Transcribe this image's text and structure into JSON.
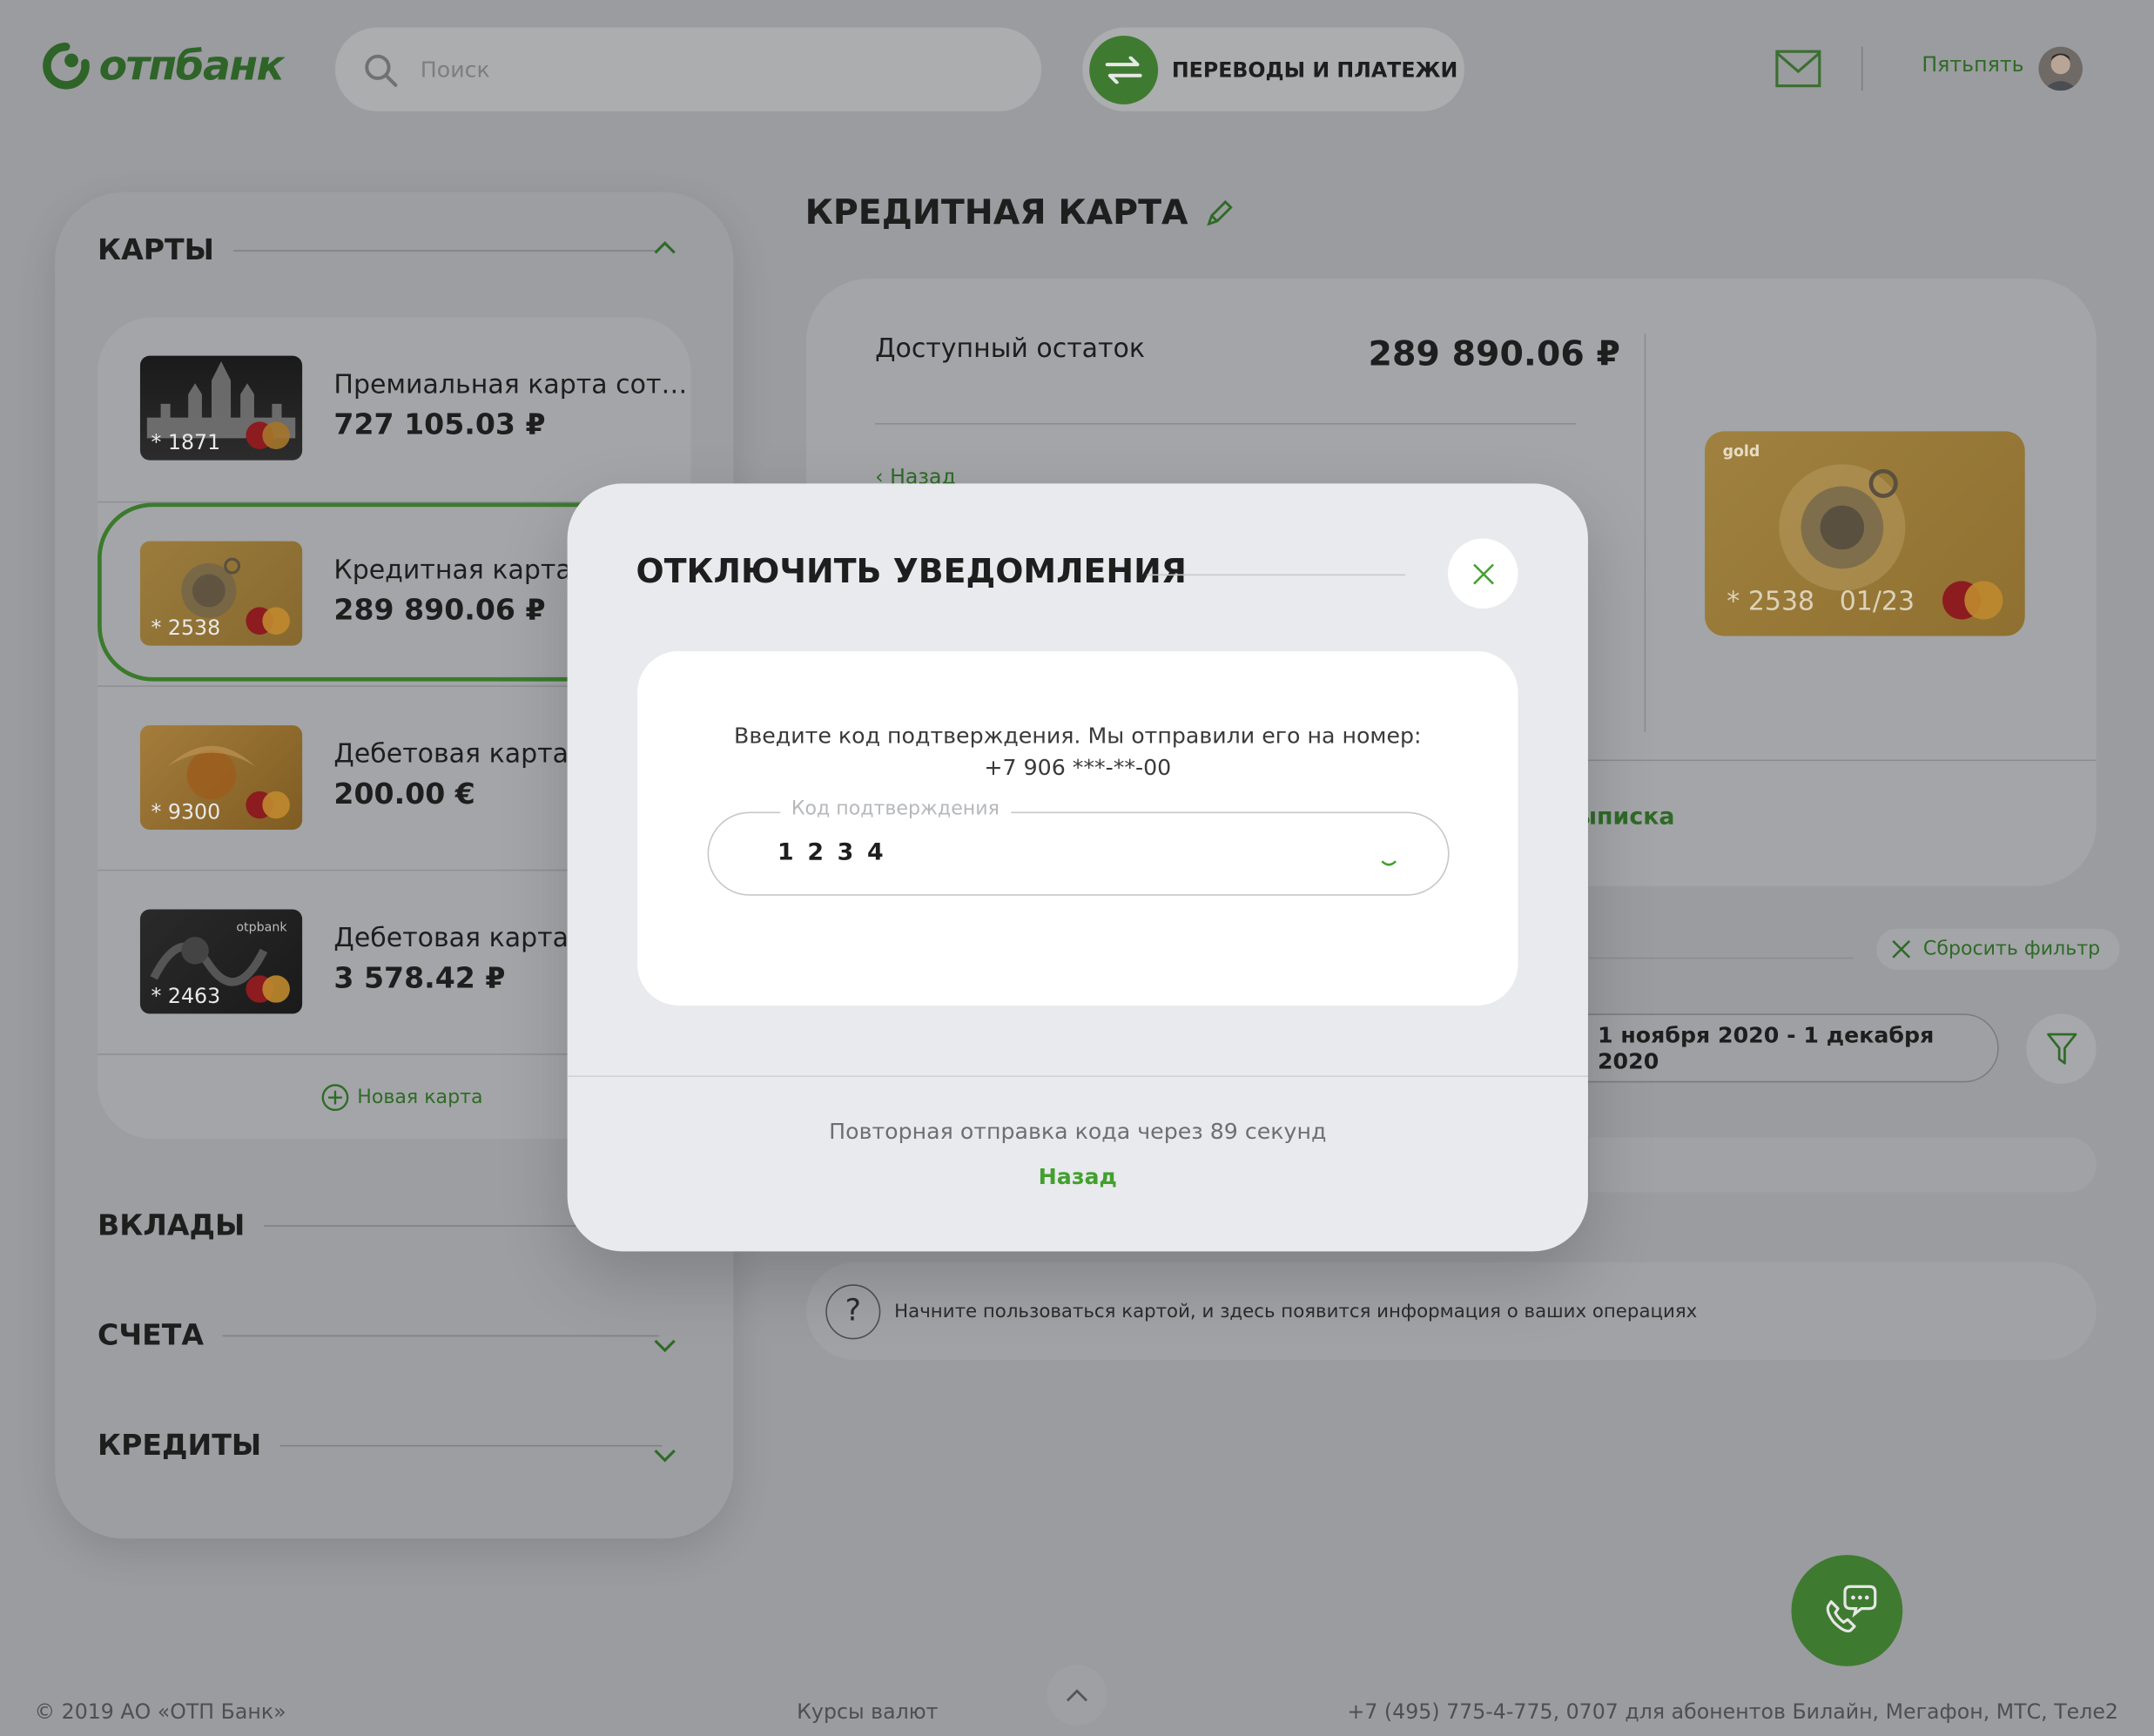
{
  "brand": {
    "name": "отпбанк",
    "green": "#3f7a31",
    "accent": "#43a02f"
  },
  "header": {
    "search_placeholder": "Поиск",
    "transfers_label": "ПЕРЕВОДЫ И ПЛАТЕЖИ",
    "user_name": "Пятьпять",
    "icons": [
      "search-icon",
      "transfer-arrows-icon",
      "mail-icon",
      "avatar"
    ]
  },
  "sidebar": {
    "cards_title": "КАРТЫ",
    "cards": [
      {
        "name": "Премиальная карта сот…",
        "balance": "727 105.03 ₽",
        "mask": "* 1871",
        "style": "dark-cathedral"
      },
      {
        "name": "Кредитная карта",
        "balance": "289 890.06 ₽",
        "mask": "* 2538",
        "style": "gold-watch",
        "selected": true
      },
      {
        "name": "Дебетовая карта",
        "balance": "200.00 €",
        "mask": "* 9300",
        "style": "gold-orange"
      },
      {
        "name": "Дебетовая карта",
        "balance": "3 578.42 ₽",
        "mask": "* 2463",
        "style": "dark-ornament"
      }
    ],
    "new_card": "Новая карта",
    "deposits_title": "ВКЛАДЫ",
    "accounts_title": "СЧЕТА",
    "credits_title": "КРЕДИТЫ"
  },
  "main": {
    "title": "КРЕДИТНАЯ КАРТА",
    "available_label": "Доступный остаток",
    "available_value": "289 890.06 ₽",
    "back_link": "Назад",
    "statement_link": "ыписка",
    "card": {
      "tier": "gold",
      "mask": "* 2538",
      "expiry": "01/23"
    },
    "reset_filter": "Сбросить фильтр",
    "date_range": "1 ноября 2020 - 1 декабря 2020",
    "info_text": "Начните пользоваться картой, и здесь появится информация о ваших операциях",
    "info_icon": "?"
  },
  "modal": {
    "title": "ОТКЛЮЧИТЬ УВЕДОМЛЕНИЯ",
    "message": "Введите код подтверждения. Мы отправили его на номер: +7 906 ***-**-00",
    "field_label": "Код подтверждения",
    "field_value": "1 2 3 4",
    "resend_text": "Повторная отправка кода через 89 секунд",
    "back_label": "Назад"
  },
  "footer": {
    "copyright": "© 2019 АО «ОТП Банк»",
    "rates": "Курсы валют",
    "phone": "+7 (495) 775-4-775,  0707 для абонентов Билайн, Мегафон, МТС, Теле2"
  }
}
